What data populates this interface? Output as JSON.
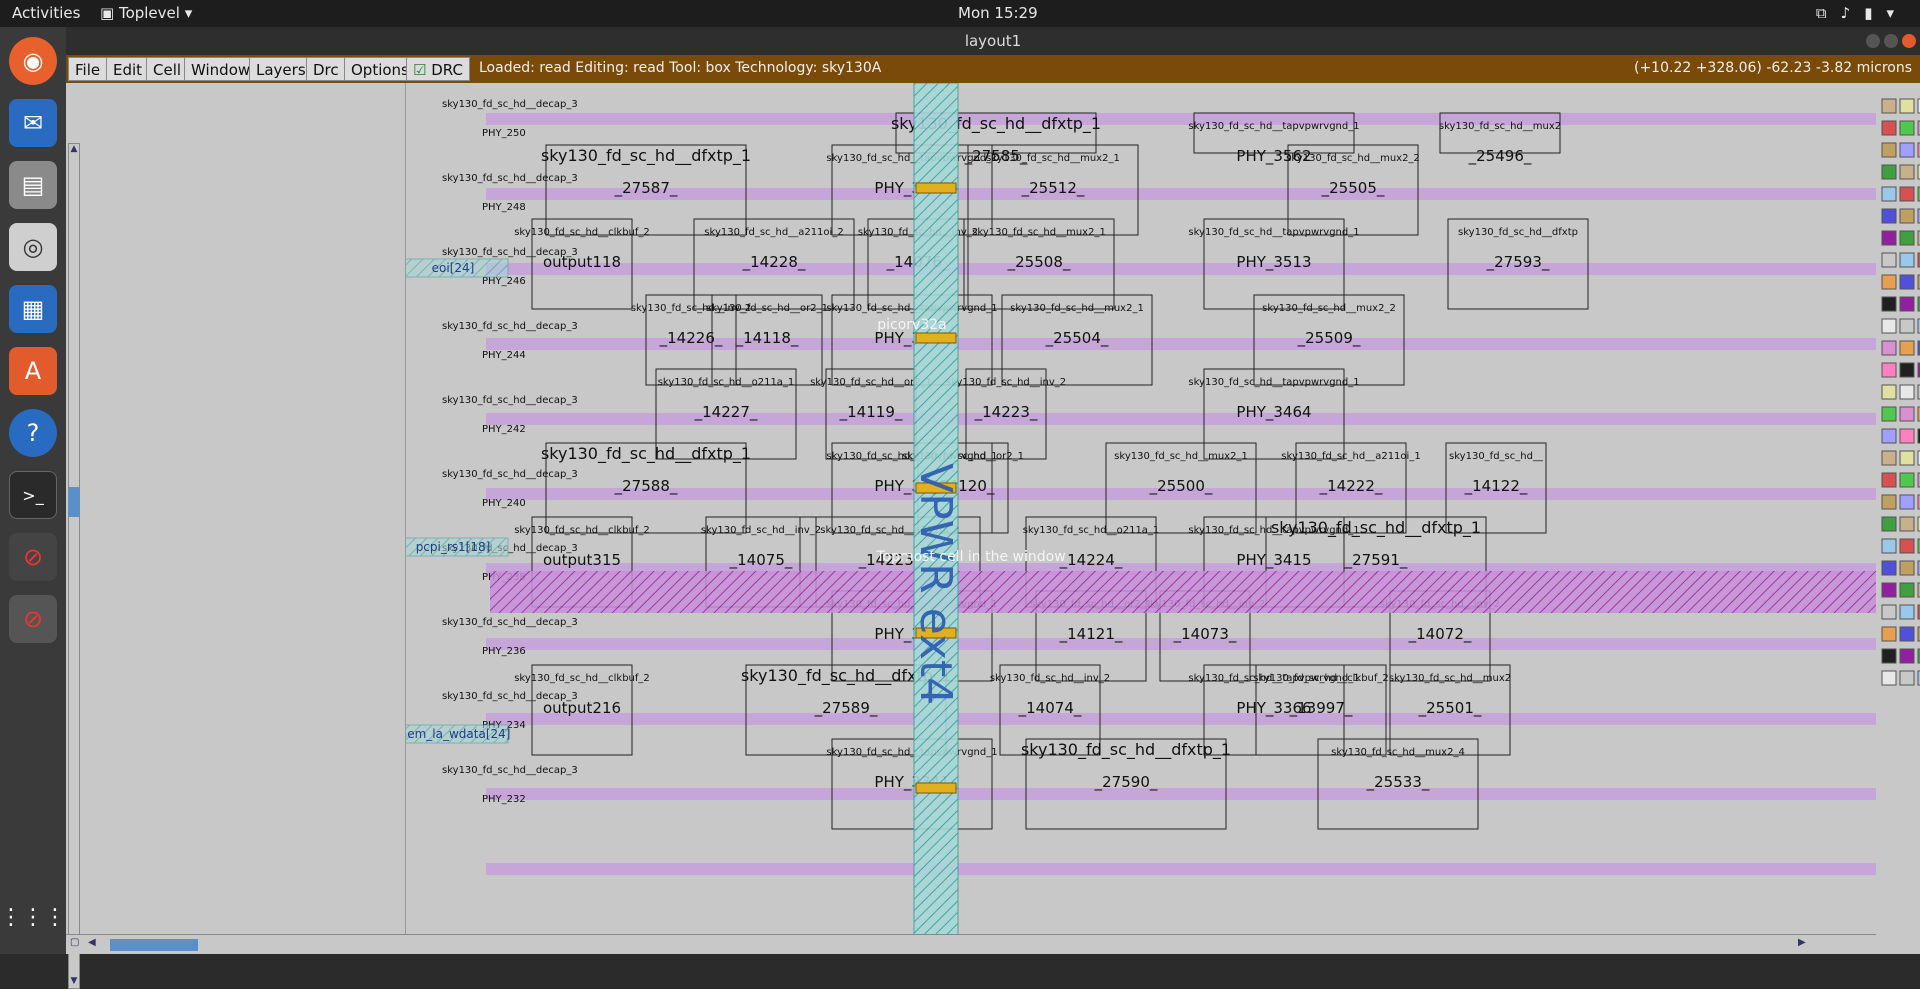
{
  "topbar": {
    "activities": "Activities",
    "app_name": "Toplevel",
    "clock": "Mon 15:29"
  },
  "window": {
    "title": "layout1"
  },
  "menubar": {
    "items": [
      "File",
      "Edit",
      "Cell",
      "Window",
      "Layers",
      "Drc",
      "Options"
    ],
    "drc_label": "DRC",
    "status": "Loaded: read Editing: read Tool: box  Technology: sky130A",
    "coords": "(+10.22 +328.06) -62.23 -3.82 microns"
  },
  "layout": {
    "pins": [
      "eoi[24]",
      "pcpi_rs1[18]",
      "mem_la_wdata[24]"
    ],
    "row_labels": [
      {
        "cell": "sky130_fd_sc_hd__decap_3",
        "phy": "PHY_250"
      },
      {
        "cell": "sky130_fd_sc_hd__decap_3",
        "phy": "PHY_248"
      },
      {
        "cell": "sky130_fd_sc_hd__decap_3",
        "phy": "PHY_246"
      },
      {
        "cell": "sky130_fd_sc_hd__decap_3",
        "phy": "PHY_244"
      },
      {
        "cell": "sky130_fd_sc_hd__decap_3",
        "phy": "PHY_242"
      },
      {
        "cell": "sky130_fd_sc_hd__decap_3",
        "phy": "PHY_240"
      },
      {
        "cell": "sky130_fd_sc_hd__decap_3",
        "phy": "PHY_238"
      },
      {
        "cell": "sky130_fd_sc_hd__decap_3",
        "phy": "PHY_236"
      },
      {
        "cell": "sky130_fd_sc_hd__decap_3",
        "phy": "PHY_234"
      },
      {
        "cell": "sky130_fd_sc_hd__decap_3",
        "phy": "PHY_232"
      }
    ],
    "cells": [
      {
        "type": "sky130_fd_sc_hd__dfxtp_1",
        "name": "_27585_"
      },
      {
        "type": "sky130_fd_sc_hd__tapvpwrvgnd_1",
        "name": "PHY_3562"
      },
      {
        "type": "sky130_fd_sc_hd__mux2",
        "name": "_25496_"
      },
      {
        "type": "sky130_fd_sc_hd__dfxtp_1",
        "name": "_27587_"
      },
      {
        "type": "sky130_fd_sc_hd__tapvpwrvgnd_1",
        "name": "PHY_3537"
      },
      {
        "type": "sky130_fd_sc_hd__mux2_1",
        "name": "_25512_"
      },
      {
        "type": "sky130_fd_sc_hd__mux2_2",
        "name": "_25505_"
      },
      {
        "type": "sky130_fd_sc_hd__clkbuf_2",
        "name": "output118"
      },
      {
        "type": "sky130_fd_sc_hd__a211oi_2",
        "name": "_14228_"
      },
      {
        "type": "sky130_fd_sc_hd__inv_2",
        "name": "_14076_"
      },
      {
        "type": "sky130_fd_sc_hd__mux2_1",
        "name": "_25508_"
      },
      {
        "type": "sky130_fd_sc_hd__tapvpwrvgnd_1",
        "name": "PHY_3513"
      },
      {
        "type": "sky130_fd_sc_hd__dfxtp",
        "name": "_27593_"
      },
      {
        "type": "sky130_fd_sc_hd__inv_2",
        "name": "_14226_"
      },
      {
        "type": "sky130_fd_sc_hd__or2_1",
        "name": "_14118_"
      },
      {
        "type": "sky130_fd_sc_hd__tapvpwrvgnd_1",
        "name": "PHY_3488"
      },
      {
        "type": "sky130_fd_sc_hd__mux2_1",
        "name": "_25504_"
      },
      {
        "type": "sky130_fd_sc_hd__mux2_2",
        "name": "_25509_"
      },
      {
        "type": "sky130_fd_sc_hd__o211a_1",
        "name": "_14227_"
      },
      {
        "type": "sky130_fd_sc_hd__or2_1",
        "name": "_14119_"
      },
      {
        "type": "sky130_fd_sc_hd__inv_2",
        "name": "_14223_"
      },
      {
        "type": "sky130_fd_sc_hd__tapvpwrvgnd_1",
        "name": "PHY_3464"
      },
      {
        "type": "sky130_fd_sc_hd__dfxtp_1",
        "name": "_27588_"
      },
      {
        "type": "sky130_fd_sc_hd__or2_1",
        "name": "_14120_"
      },
      {
        "type": "sky130_fd_sc_hd__tapvpwrvgnd_1",
        "name": "PHY_3439"
      },
      {
        "type": "sky130_fd_sc_hd__mux2_1",
        "name": "_25500_"
      },
      {
        "type": "sky130_fd_sc_hd__a211oi_1",
        "name": "_14222_"
      },
      {
        "type": "sky130_fd_sc_hd__",
        "name": "_14122_"
      },
      {
        "type": "sky130_fd_sc_hd__clkbuf_2",
        "name": "output315"
      },
      {
        "type": "sky130_fd_sc_hd__inv_2",
        "name": "_14075_"
      },
      {
        "type": "sky130_fd_sc_hd__a211oi_2",
        "name": "_14225_"
      },
      {
        "type": "sky130_fd_sc_hd__o211a_1",
        "name": "_14224_"
      },
      {
        "type": "sky130_fd_sc_hd__tapvpwrvgnd_1",
        "name": "PHY_3415"
      },
      {
        "type": "sky130_fd_sc_hd__dfxtp_1",
        "name": "_27591_"
      },
      {
        "type": "sky130_fd_sc_hd__or2_1",
        "name": "_14121_"
      },
      {
        "type": "sky130_fd_sc_hd__inv_2",
        "name": "_14073_"
      },
      {
        "type": "sky130_fd_sc_hd__inv_2",
        "name": "_14072_"
      },
      {
        "type": "sky130_fd_sc_hd__tapvpwrvgnd_1",
        "name": "PHY_3390"
      },
      {
        "type": "sky130_fd_sc_hd__clkbuf_2",
        "name": "output216"
      },
      {
        "type": "sky130_fd_sc_hd__dfxtp_1",
        "name": "_27589_"
      },
      {
        "type": "sky130_fd_sc_hd__inv_2",
        "name": "_14074_"
      },
      {
        "type": "sky130_fd_sc_hd__tapvpwrvgnd_1",
        "name": "PHY_3366"
      },
      {
        "type": "sky130_fd_sc_hd__clkbuf_2",
        "name": "_13997_"
      },
      {
        "type": "sky130_fd_sc_hd__mux2",
        "name": "_25501_"
      },
      {
        "type": "sky130_fd_sc_hd__tapvpwrvgnd_1",
        "name": "PHY_3341"
      },
      {
        "type": "sky130_fd_sc_hd__dfxtp_1",
        "name": "_27590_"
      },
      {
        "type": "sky130_fd_sc_hd__mux2_4",
        "name": "_25533_"
      }
    ],
    "top_label": "picorv32a",
    "hint": "Topmost cell in the window",
    "vertical_label": "VPWR ext4"
  }
}
